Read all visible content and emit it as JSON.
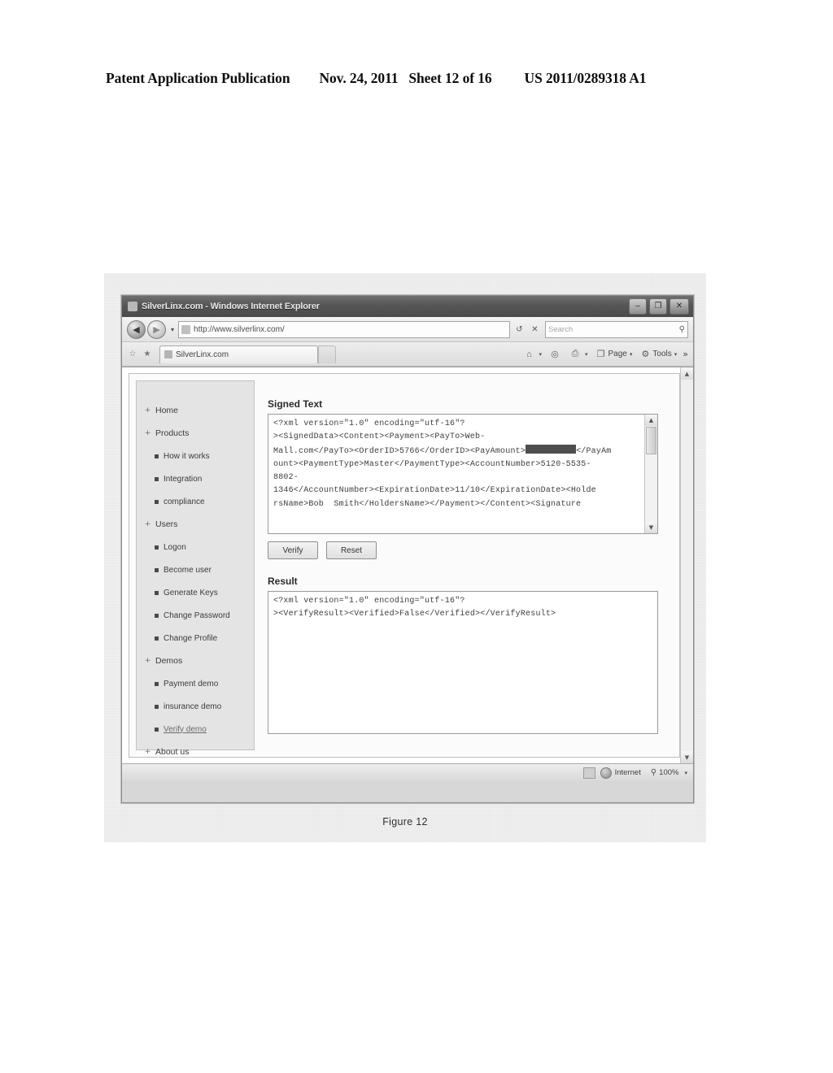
{
  "patent_header": {
    "publication": "Patent Application Publication",
    "date": "Nov. 24, 2011",
    "sheet": "Sheet 12 of 16",
    "number": "US 2011/0289318 A1"
  },
  "figure": {
    "caption": "Figure 12"
  },
  "browser": {
    "titlebar": {
      "title": "SilverLinx.com - Windows Internet Explorer",
      "minimize_label": "–",
      "maximize_label": "❐",
      "close_label": "✕"
    },
    "address_bar": {
      "back_icon": "◀",
      "forward_icon": "▶",
      "history_dropdown_icon": "▾",
      "favicon": "favicon-icon",
      "url": "http://www.silverlinx.com/",
      "refresh_icon": "↺",
      "stop_icon": "✕",
      "search_placeholder": "Search",
      "search_icon": "⚲"
    },
    "command_bar": {
      "favorites_add_icon": "☆",
      "favorites_center_icon": "★",
      "tab_label": "SilverLinx.com",
      "home_label": "",
      "home_icon": "⌂",
      "feeds_icon": "◎",
      "print_icon": "⎙",
      "page_label": "Page",
      "page_icon": "❐",
      "tools_label": "Tools",
      "tools_icon": "⚙",
      "overflow_icon": "»",
      "dropdown_icon": "▾"
    },
    "status_bar": {
      "zone_label": "Internet",
      "protected_mode_icon": "shield-icon",
      "zoom_level": "100%",
      "zoom_icon": "⚲",
      "zoom_dropdown_icon": "▾"
    }
  },
  "sidebar": {
    "items": [
      {
        "label": "Home",
        "level": 1,
        "marker": "plus",
        "active": false
      },
      {
        "label": "Products",
        "level": 1,
        "marker": "plus",
        "active": false
      },
      {
        "label": "How it works",
        "level": 2,
        "marker": "square",
        "active": false
      },
      {
        "label": "Integration",
        "level": 2,
        "marker": "square",
        "active": false
      },
      {
        "label": "compliance",
        "level": 2,
        "marker": "square",
        "active": false
      },
      {
        "label": "Users",
        "level": 1,
        "marker": "plus",
        "active": false
      },
      {
        "label": "Logon",
        "level": 2,
        "marker": "square",
        "active": false
      },
      {
        "label": "Become user",
        "level": 2,
        "marker": "square",
        "active": false
      },
      {
        "label": "Generate Keys",
        "level": 2,
        "marker": "square",
        "active": false
      },
      {
        "label": "Change Password",
        "level": 2,
        "marker": "square",
        "active": false
      },
      {
        "label": "Change Profile",
        "level": 2,
        "marker": "square",
        "active": false
      },
      {
        "label": "Demos",
        "level": 1,
        "marker": "plus",
        "active": false
      },
      {
        "label": "Payment demo",
        "level": 2,
        "marker": "square",
        "active": false
      },
      {
        "label": "insurance demo",
        "level": 2,
        "marker": "square",
        "active": false
      },
      {
        "label": "Verify demo",
        "level": 2,
        "marker": "square",
        "active": true
      },
      {
        "label": "About us",
        "level": 1,
        "marker": "plus",
        "active": false
      }
    ]
  },
  "main": {
    "signed_text": {
      "title": "Signed Text",
      "line1": "<?xml version=\"1.0\" encoding=\"utf-16\"?",
      "line2": "><SignedData><Content><Payment><PayTo>Web-",
      "line3_a": "Mall.com</PayTo><OrderID>5766</OrderID><PayAmount>",
      "line3_redacted": "",
      "line3_b": "</PayAm",
      "line4": "ount><PaymentType>Master</PaymentType><AccountNumber>5120-5535-",
      "line5": "8802-",
      "line6": "1346</AccountNumber><ExpirationDate>11/10</ExpirationDate><Holde",
      "line7": "rsName>Bob  Smith</HoldersName></Payment></Content><Signature",
      "scroll_up_icon": "▲",
      "scroll_down_icon": "▼"
    },
    "buttons": {
      "verify_label": "Verify",
      "reset_label": "Reset"
    },
    "result": {
      "title": "Result",
      "line1": "<?xml version=\"1.0\" encoding=\"utf-16\"?",
      "line2": "><VerifyResult><Verified>False</Verified></VerifyResult>"
    },
    "page_scroll": {
      "up_icon": "▲",
      "down_icon": "▼"
    }
  }
}
